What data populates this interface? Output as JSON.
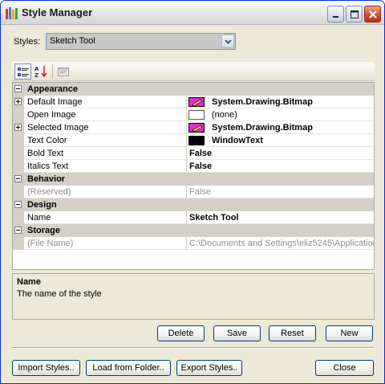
{
  "window": {
    "title": "Style Manager",
    "accent": "#0831d9"
  },
  "titlebar_buttons": {
    "minimize": "minimize-icon",
    "maximize": "maximize-icon",
    "close": "close-icon"
  },
  "styles_selector": {
    "label": "Styles:",
    "selected": "Sketch Tool"
  },
  "toolbar": {
    "buttons": [
      "categorized-icon",
      "alphabetical-icon",
      "property-pages-icon"
    ]
  },
  "property_grid": {
    "categories": [
      {
        "name": "Appearance",
        "properties": [
          {
            "name": "Default Image",
            "value": "System.Drawing.Bitmap",
            "expandable": true,
            "swatch": "bitmap",
            "bold": true
          },
          {
            "name": "Open Image",
            "value": "(none)",
            "expandable": false,
            "swatch": "empty",
            "bold": false
          },
          {
            "name": "Selected Image",
            "value": "System.Drawing.Bitmap",
            "expandable": true,
            "swatch": "bitmap",
            "bold": true
          },
          {
            "name": "Text Color",
            "value": "WindowText",
            "expandable": false,
            "swatch": "black",
            "bold": true
          },
          {
            "name": "Bold Text",
            "value": "False",
            "expandable": false,
            "bold": true
          },
          {
            "name": "Italics Text",
            "value": "False",
            "expandable": false,
            "bold": true
          }
        ]
      },
      {
        "name": "Behavior",
        "properties": [
          {
            "name": "(Reserved)",
            "value": "False",
            "readonly": true
          }
        ]
      },
      {
        "name": "Design",
        "properties": [
          {
            "name": "Name",
            "value": "Sketch Tool",
            "bold": true
          }
        ]
      },
      {
        "name": "Storage",
        "properties": [
          {
            "name": "(File Name)",
            "value": "C:\\Documents and Settings\\eliz5245\\Application",
            "readonly": true
          }
        ]
      }
    ]
  },
  "description": {
    "title": "Name",
    "text": "The name of the style"
  },
  "action_buttons": {
    "delete": "Delete",
    "save": "Save",
    "reset": "Reset",
    "new": "New"
  },
  "footer_buttons": {
    "import": "Import Styles..",
    "load": "Load  from Folder..",
    "export": "Export Styles..",
    "close": "Close"
  },
  "colors": {
    "swatch_bitmap": "#e629d2",
    "category_background": "#d4d0c8",
    "dialog_background": "#ece9d8"
  }
}
